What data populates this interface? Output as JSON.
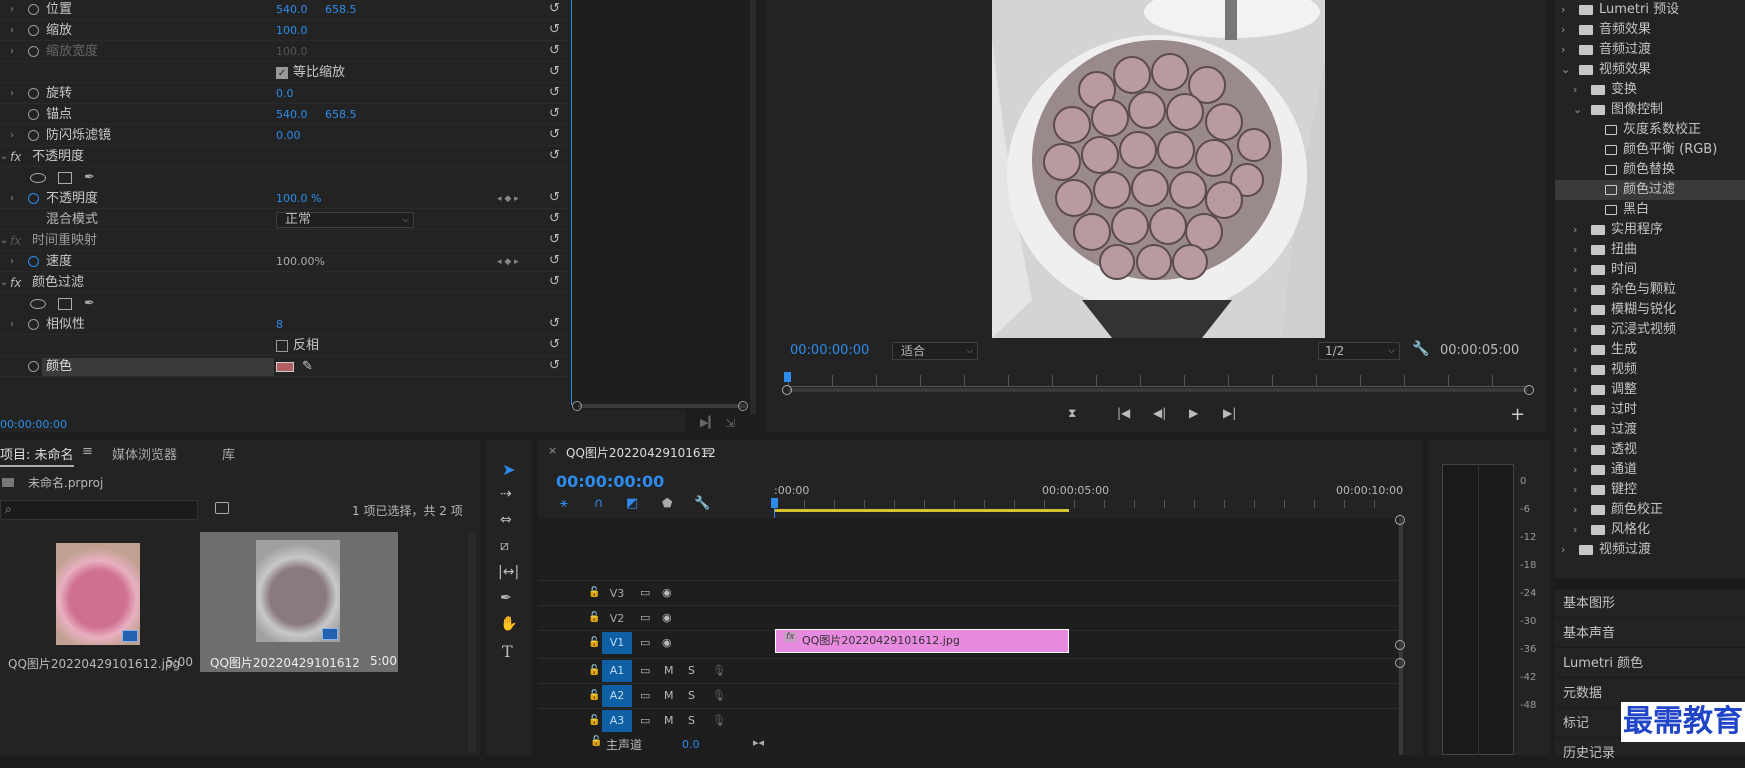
{
  "effect_controls": {
    "rows": [
      {
        "label": "位置",
        "v1": "540.0",
        "v2": "658.5"
      },
      {
        "label": "缩放",
        "v1": "100.0"
      },
      {
        "label": "缩放宽度",
        "v1": "100.0"
      },
      {
        "label": "等比缩放"
      },
      {
        "label": "旋转",
        "v1": "0.0"
      },
      {
        "label": "锚点",
        "v1": "540.0",
        "v2": "658.5"
      },
      {
        "label": "防闪烁滤镜",
        "v1": "0.00"
      },
      {
        "label": "不透明度"
      },
      {
        "label": "不透明度",
        "v1": "100.0 %"
      },
      {
        "label": "混合模式",
        "v1": "正常"
      },
      {
        "label": "时间重映射"
      },
      {
        "label": "速度",
        "v1": "100.00%"
      },
      {
        "label": "颜色过滤"
      },
      {
        "label": "相似性",
        "v1": "8"
      },
      {
        "label": "反相"
      },
      {
        "label": "颜色"
      }
    ],
    "fx_label": "fx",
    "timecode": "00:00:00:00"
  },
  "monitor": {
    "timecode": "00:00:00:00",
    "fit": "适合",
    "resolution": "1/2",
    "duration": "00:00:05:00"
  },
  "project": {
    "tabs": [
      "项目: 未命名",
      "媒体浏览器",
      "库"
    ],
    "file": "未命名.prproj",
    "selection": "1 项已选择，共 2 项",
    "items": [
      {
        "name": "QQ图片20220429101612.jpg",
        "dur": "5:00"
      },
      {
        "name": "QQ图片20220429101612",
        "dur": "5:00"
      }
    ]
  },
  "timeline": {
    "tab": "QQ图片20220429101612",
    "timecode": "00:00:00:00",
    "ruler": [
      ":00:00",
      "00:00:05:00",
      "00:00:10:00"
    ],
    "video_tracks": [
      "V3",
      "V2",
      "V1"
    ],
    "audio_tracks": [
      "A1",
      "A2",
      "A3"
    ],
    "master_label": "主声道",
    "master_value": "0.0",
    "clip_name": "QQ图片20220429101612.jpg",
    "clip_fx": "fx",
    "m": "M",
    "s": "S"
  },
  "meter": {
    "ticks": [
      "0",
      "-6",
      "-12",
      "-18",
      "-24",
      "-30",
      "-36",
      "-42",
      "-48"
    ]
  },
  "effects": {
    "items": [
      {
        "label": "Lumetri 预设",
        "level": 0,
        "type": "folder",
        "open": false
      },
      {
        "label": "音频效果",
        "level": 0,
        "type": "folder",
        "open": false
      },
      {
        "label": "音频过渡",
        "level": 0,
        "type": "folder",
        "open": false
      },
      {
        "label": "视频效果",
        "level": 0,
        "type": "folder",
        "open": true
      },
      {
        "label": "变换",
        "level": 1,
        "type": "folder",
        "open": false
      },
      {
        "label": "图像控制",
        "level": 1,
        "type": "folder",
        "open": true
      },
      {
        "label": "灰度系数校正",
        "level": 2,
        "type": "fx"
      },
      {
        "label": "颜色平衡 (RGB)",
        "level": 2,
        "type": "fx"
      },
      {
        "label": "颜色替换",
        "level": 2,
        "type": "fx"
      },
      {
        "label": "颜色过滤",
        "level": 2,
        "type": "fx",
        "selected": true
      },
      {
        "label": "黑白",
        "level": 2,
        "type": "fx"
      },
      {
        "label": "实用程序",
        "level": 1,
        "type": "folder",
        "open": false
      },
      {
        "label": "扭曲",
        "level": 1,
        "type": "folder",
        "open": false
      },
      {
        "label": "时间",
        "level": 1,
        "type": "folder",
        "open": false
      },
      {
        "label": "杂色与颗粒",
        "level": 1,
        "type": "folder",
        "open": false
      },
      {
        "label": "模糊与锐化",
        "level": 1,
        "type": "folder",
        "open": false
      },
      {
        "label": "沉浸式视频",
        "level": 1,
        "type": "folder",
        "open": false
      },
      {
        "label": "生成",
        "level": 1,
        "type": "folder",
        "open": false
      },
      {
        "label": "视频",
        "level": 1,
        "type": "folder",
        "open": false
      },
      {
        "label": "调整",
        "level": 1,
        "type": "folder",
        "open": false
      },
      {
        "label": "过时",
        "level": 1,
        "type": "folder",
        "open": false
      },
      {
        "label": "过渡",
        "level": 1,
        "type": "folder",
        "open": false
      },
      {
        "label": "透视",
        "level": 1,
        "type": "folder",
        "open": false
      },
      {
        "label": "通道",
        "level": 1,
        "type": "folder",
        "open": false
      },
      {
        "label": "键控",
        "level": 1,
        "type": "folder",
        "open": false
      },
      {
        "label": "颜色校正",
        "level": 1,
        "type": "folder",
        "open": false
      },
      {
        "label": "风格化",
        "level": 1,
        "type": "folder",
        "open": false
      },
      {
        "label": "视频过渡",
        "level": 0,
        "type": "folder",
        "open": false
      }
    ],
    "panels": [
      "基本图形",
      "基本声音",
      "Lumetri 颜色",
      "元数据",
      "标记",
      "历史记录"
    ]
  },
  "watermark": "最需教育",
  "colors": {
    "accent": "#2d8ceb",
    "clip": "#e88ae0",
    "filter_color": "#b06060",
    "track_btn": "#0e5fa3"
  }
}
